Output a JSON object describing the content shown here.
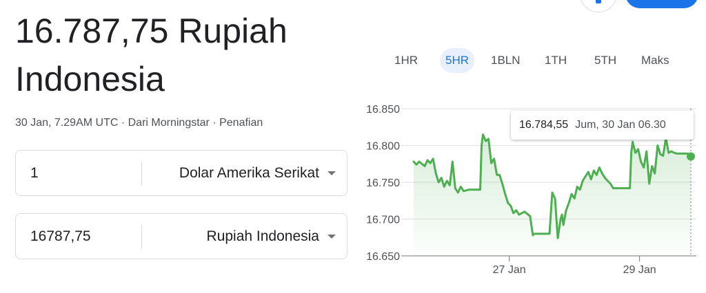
{
  "headline": "16.787,75 Rupiah Indonesia",
  "meta": {
    "timestamp": "30 Jan, 7.29AM UTC",
    "separator": " · ",
    "source": "Dari Morningstar",
    "disclaimer": "Penafian"
  },
  "converter": {
    "from": {
      "amount": "1",
      "currency": "Dolar Amerika Serikat"
    },
    "to": {
      "amount": "16787,75",
      "currency": "Rupiah Indonesia"
    }
  },
  "range_tabs": [
    "1HR",
    "5HR",
    "1BLN",
    "1TH",
    "5TH",
    "Maks"
  ],
  "active_tab": "5HR",
  "tooltip": {
    "value": "16.784,55",
    "date": "Jum, 30 Jan 06.30"
  },
  "colors": {
    "line": "#4caf50",
    "accent": "#1a73e8"
  },
  "chart_data": {
    "type": "area",
    "ylim": [
      16650,
      16850
    ],
    "yticks": [
      "16.850",
      "16.800",
      "16.750",
      "16.700",
      "16.650"
    ],
    "ytick_values": [
      16850,
      16800,
      16750,
      16700,
      16650
    ],
    "xticks": [
      "27 Jan",
      "29 Jan"
    ],
    "xtick_positions": [
      0.345,
      0.815
    ],
    "grid": "horizontal",
    "series": [
      {
        "x": [
          0,
          0.01,
          0.02,
          0.04,
          0.05,
          0.06,
          0.07,
          0.08,
          0.09,
          0.1,
          0.11,
          0.12,
          0.13,
          0.14,
          0.15,
          0.16,
          0.17,
          0.18,
          0.2,
          0.22,
          0.24,
          0.245,
          0.25,
          0.26,
          0.27,
          0.28,
          0.29,
          0.3,
          0.31,
          0.32,
          0.33,
          0.34,
          0.35,
          0.36,
          0.37,
          0.38,
          0.39,
          0.4,
          0.42,
          0.43,
          0.435,
          0.44,
          0.49,
          0.5,
          0.51,
          0.52,
          0.53,
          0.535,
          0.54,
          0.55,
          0.56,
          0.57,
          0.58,
          0.59,
          0.6,
          0.61,
          0.62,
          0.63,
          0.64,
          0.65,
          0.66,
          0.67,
          0.68,
          0.69,
          0.7,
          0.71,
          0.72,
          0.735,
          0.74,
          0.78,
          0.785,
          0.79,
          0.8,
          0.81,
          0.82,
          0.83,
          0.84,
          0.85,
          0.86,
          0.87,
          0.88,
          0.89,
          0.9,
          0.91,
          0.92,
          0.93,
          0.94,
          0.95,
          0.97,
          0.99,
          1.0
        ],
        "values": [
          16778,
          16774,
          16778,
          16772,
          16780,
          16776,
          16782,
          16762,
          16750,
          16756,
          16744,
          16752,
          16746,
          16778,
          16742,
          16736,
          16744,
          16738,
          16740,
          16740,
          16740,
          16800,
          16815,
          16806,
          16809,
          16776,
          16782,
          16760,
          16760,
          16748,
          16734,
          16722,
          16718,
          16708,
          16712,
          16706,
          16708,
          16710,
          16704,
          16678,
          16680,
          16680,
          16680,
          16736,
          16728,
          16674,
          16700,
          16706,
          16692,
          16712,
          16722,
          16734,
          16728,
          16744,
          16740,
          16752,
          16758,
          16764,
          16754,
          16766,
          16760,
          16770,
          16762,
          16756,
          16752,
          16748,
          16742,
          16742,
          16742,
          16742,
          16790,
          16805,
          16790,
          16795,
          16778,
          16770,
          16792,
          16748,
          16772,
          16762,
          16800,
          16788,
          16786,
          16810,
          16790,
          16792,
          16790,
          16789,
          16789,
          16789,
          16785
        ]
      }
    ]
  }
}
